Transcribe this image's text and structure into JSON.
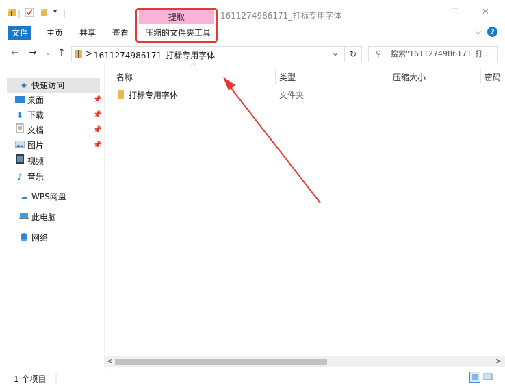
{
  "window": {
    "title": "1611274986171_打标专用字体",
    "controls": {
      "minimize": "—",
      "maximize": "☐",
      "close": "✕"
    }
  },
  "ribbon": {
    "tabs": [
      "文件",
      "主页",
      "共享",
      "查看"
    ],
    "context_header": "提取",
    "context_tab": "压缩的文件夹工具",
    "collapse": "⌵",
    "help": "?"
  },
  "address": {
    "path_sep": ">",
    "path": "1611274986171_打标专用字体",
    "dropdown": "⌄",
    "refresh": "↻",
    "search_placeholder": "搜索\"1611274986171_打..."
  },
  "sidebar": {
    "items": [
      {
        "label": "快速访问",
        "icon": "star-icon"
      },
      {
        "label": "桌面",
        "icon": "desktop-icon",
        "pinned": true
      },
      {
        "label": "下载",
        "icon": "download-icon",
        "pinned": true
      },
      {
        "label": "文档",
        "icon": "document-icon",
        "pinned": true
      },
      {
        "label": "图片",
        "icon": "picture-icon",
        "pinned": true
      },
      {
        "label": "视频",
        "icon": "video-icon"
      },
      {
        "label": "音乐",
        "icon": "music-icon"
      },
      {
        "label": "WPS网盘",
        "icon": "cloud-icon"
      },
      {
        "label": "此电脑",
        "icon": "computer-icon"
      },
      {
        "label": "网络",
        "icon": "network-icon"
      }
    ]
  },
  "content": {
    "columns": [
      "名称",
      "类型",
      "压缩大小",
      "密码"
    ],
    "rows": [
      {
        "name": "打标专用字体",
        "type": "文件夹"
      }
    ]
  },
  "status": {
    "count": "1 个项目"
  },
  "colors": {
    "accent": "#1979ca",
    "context_header": "#f8b3d6",
    "annotation": "#e53935"
  }
}
